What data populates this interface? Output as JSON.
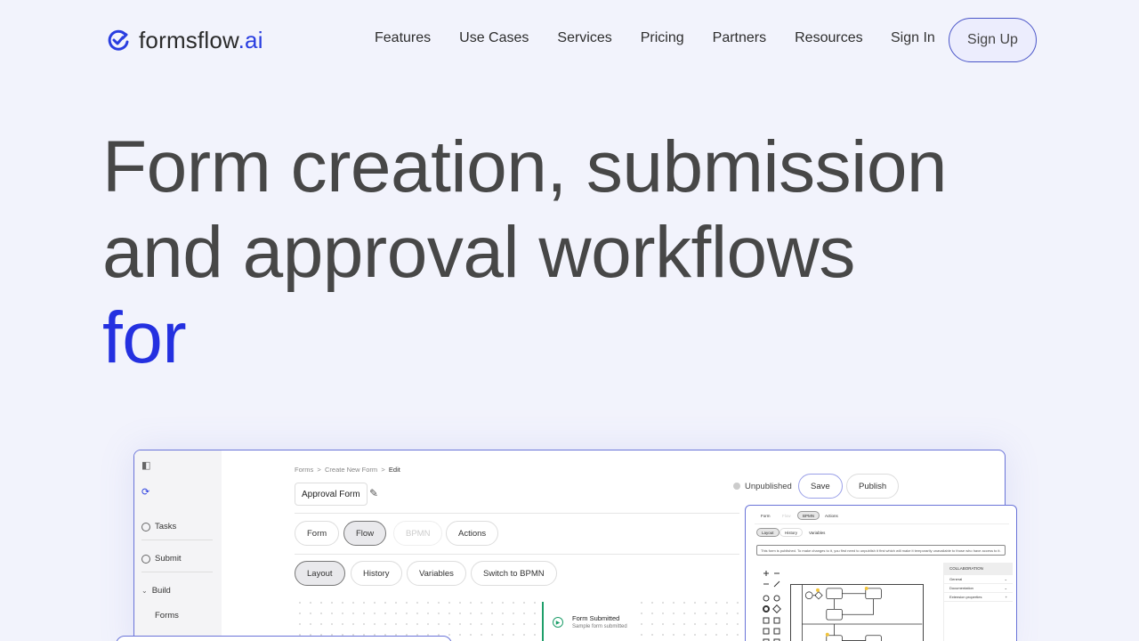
{
  "brand": {
    "name": "formsflow",
    "suffix": ".ai",
    "accent": "#2a3ee0",
    "icon": "refresh-check-icon"
  },
  "nav": {
    "links": [
      "Features",
      "Use Cases",
      "Services",
      "Pricing",
      "Partners",
      "Resources"
    ],
    "sign_in": "Sign In",
    "sign_up": "Sign Up"
  },
  "hero": {
    "line1": "Form creation, submission",
    "line2": "and approval workflows",
    "line3": "for",
    "accent_color": "#2430e0"
  },
  "preview": {
    "sidebar": {
      "items": [
        "Tasks",
        "Submit",
        "Build",
        "Forms"
      ]
    },
    "breadcrumb": {
      "a": "Forms",
      "b": "Create New Form",
      "c": "Edit",
      "sep": ">"
    },
    "form_name": "Approval Form",
    "status": "Unpublished",
    "save": "Save",
    "publish": "Publish",
    "tabs": [
      "Form",
      "Flow",
      "BPMN",
      "Actions"
    ],
    "subtabs": [
      "Layout",
      "History",
      "Variables",
      "Switch to BPMN"
    ],
    "node": {
      "title": "Form Submitted",
      "subtitle": "Sample form submitted"
    }
  },
  "overlay": {
    "tabs": [
      "Form",
      "Flow",
      "BPMN",
      "Actions"
    ],
    "subtabs": [
      "Layout",
      "History",
      "Variables"
    ],
    "banner": "This form is published. To make changes to it, you first need to unpublish it first which will make it temporarily unavailable to those who have access to it.",
    "props": {
      "header": "COLLABORATION",
      "rows": [
        "General",
        "Documentation",
        "Extension properties"
      ]
    }
  }
}
